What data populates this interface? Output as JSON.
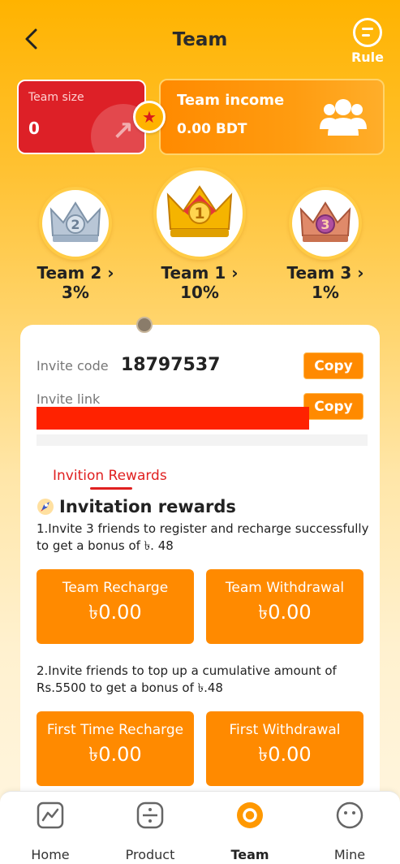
{
  "header": {
    "title": "Team",
    "rule_label": "Rule"
  },
  "stats": {
    "team_size_label": "Team size",
    "team_size_value": "0",
    "team_income_label": "Team income",
    "team_income_value": "0.00 BDT"
  },
  "teams": [
    {
      "name": "Team 2 ›",
      "percent": "3%",
      "rank": "2",
      "color": "#b8c6d6"
    },
    {
      "name": "Team 1 ›",
      "percent": "10%",
      "rank": "1",
      "color": "#f5b400"
    },
    {
      "name": "Team 3 ›",
      "percent": "1%",
      "rank": "3",
      "color": "#e08a6a"
    }
  ],
  "invite": {
    "code_label": "Invite code",
    "code_value": "18797537",
    "copy_label": "Copy",
    "link_label": "Invite link"
  },
  "rewards": {
    "tab_label": "Invition Rewards",
    "title": "Invitation rewards",
    "rule1": "1.Invite 3 friends to register and recharge successfully to get a bonus of ৳. 48",
    "rule2": "2.Invite friends to top up a cumulative amount of Rs.5500 to get a bonus of ৳.48",
    "boxes": [
      {
        "label": "Team Recharge",
        "value": "৳0.00"
      },
      {
        "label": "Team Withdrawal",
        "value": "৳0.00"
      },
      {
        "label": "First Time Recharge",
        "value": "৳0.00"
      },
      {
        "label": "First Withdrawal",
        "value": "৳0.00"
      }
    ]
  },
  "nav": {
    "items": [
      {
        "label": "Home",
        "icon": "chart-icon",
        "active": false
      },
      {
        "label": "Product",
        "icon": "product-icon",
        "active": false
      },
      {
        "label": "Team",
        "icon": "team-icon",
        "active": true
      },
      {
        "label": "Mine",
        "icon": "mine-icon",
        "active": false
      }
    ]
  },
  "colors": {
    "accent": "#ff8a00",
    "red": "#dd2027",
    "tab_red": "#e02020"
  }
}
